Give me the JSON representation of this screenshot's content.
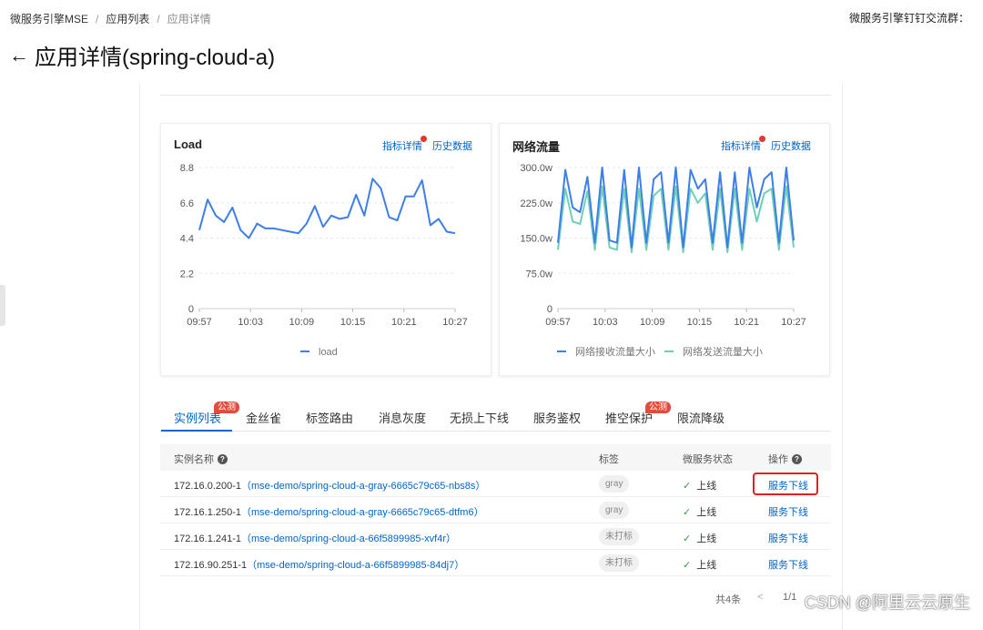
{
  "breadcrumb": [
    "微服务引擎MSE",
    "应用列表",
    "应用详情"
  ],
  "top_right": "微服务引擎钉钉交流群：",
  "page_title": "应用详情(spring-cloud-a)",
  "cards": [
    {
      "title": "Load",
      "link1": "指标详情",
      "link2": "历史数据"
    },
    {
      "title": "网络流量",
      "link1": "指标详情",
      "link2": "历史数据"
    }
  ],
  "tabs": [
    {
      "label": "实例列表",
      "badge": "公测"
    },
    {
      "label": "金丝雀",
      "badge": ""
    },
    {
      "label": "标签路由",
      "badge": ""
    },
    {
      "label": "消息灰度",
      "badge": ""
    },
    {
      "label": "无损上下线",
      "badge": ""
    },
    {
      "label": "服务鉴权",
      "badge": ""
    },
    {
      "label": "推空保护",
      "badge": "公测"
    },
    {
      "label": "限流降级",
      "badge": ""
    }
  ],
  "table": {
    "headers": {
      "name": "实例名称",
      "tag": "标签",
      "status": "微服务状态",
      "action": "操作"
    },
    "rows": [
      {
        "ip": "172.16.0.200-1",
        "pod": "（mse-demo/spring-cloud-a-gray-6665c79c65-nbs8s）",
        "tag": "gray",
        "status": "上线",
        "action": "服务下线"
      },
      {
        "ip": "172.16.1.250-1",
        "pod": "（mse-demo/spring-cloud-a-gray-6665c79c65-dtfm6）",
        "tag": "gray",
        "status": "上线",
        "action": "服务下线"
      },
      {
        "ip": "172.16.1.241-1",
        "pod": "（mse-demo/spring-cloud-a-66f5899985-xvf4r）",
        "tag": "未打标",
        "status": "上线",
        "action": "服务下线"
      },
      {
        "ip": "172.16.90.251-1",
        "pod": "（mse-demo/spring-cloud-a-66f5899985-84dj7）",
        "tag": "未打标",
        "status": "上线",
        "action": "服务下线"
      }
    ]
  },
  "pager": {
    "total": "共4条",
    "prev": "<",
    "page": "1/1"
  },
  "watermark": "CSDN @阿里云云原生",
  "colors": {
    "accent": "#0064c8",
    "series_blue": "#3e7ee8",
    "series_teal": "#6fcfb5",
    "badge_red": "#e24c3e"
  },
  "chart_data": [
    {
      "type": "line",
      "title": "Load",
      "x_ticks": [
        "09:57",
        "10:03",
        "10:09",
        "10:15",
        "10:21",
        "10:27"
      ],
      "y_ticks": [
        "8.8",
        "6.6",
        "4.4",
        "2.2",
        "0"
      ],
      "ylim": [
        0,
        8.8
      ],
      "legend": "bottom",
      "series": [
        {
          "name": "load",
          "color": "#3e7ee8",
          "values": [
            4.9,
            6.8,
            5.8,
            5.4,
            6.3,
            4.9,
            4.4,
            5.3,
            5.0,
            5.0,
            4.9,
            4.8,
            4.7,
            5.3,
            6.4,
            5.1,
            5.8,
            5.6,
            5.7,
            7.1,
            5.8,
            8.1,
            7.5,
            5.7,
            5.5,
            7.0,
            7.0,
            8.0,
            5.2,
            5.6,
            4.8,
            4.7
          ]
        }
      ]
    },
    {
      "type": "line",
      "title": "网络流量",
      "x_ticks": [
        "09:57",
        "10:03",
        "10:09",
        "10:15",
        "10:21",
        "10:27"
      ],
      "y_ticks": [
        "300.0w",
        "225.0w",
        "150.0w",
        "75.0w",
        "0"
      ],
      "ylim": [
        0,
        300
      ],
      "legend": "bottom",
      "series": [
        {
          "name": "网络接收流量大小",
          "color": "#3e7ee8",
          "values": [
            140,
            295,
            215,
            205,
            280,
            140,
            300,
            145,
            140,
            295,
            130,
            300,
            140,
            275,
            290,
            140,
            300,
            130,
            295,
            255,
            275,
            140,
            290,
            130,
            290,
            140,
            300,
            215,
            275,
            290,
            140,
            300,
            145
          ]
        },
        {
          "name": "网络发送流量大小",
          "color": "#6fcfb5",
          "values": [
            125,
            255,
            185,
            180,
            250,
            125,
            260,
            130,
            125,
            255,
            120,
            255,
            125,
            240,
            255,
            125,
            260,
            120,
            255,
            225,
            245,
            125,
            255,
            120,
            255,
            125,
            255,
            185,
            245,
            255,
            125,
            260,
            130
          ]
        }
      ]
    }
  ]
}
